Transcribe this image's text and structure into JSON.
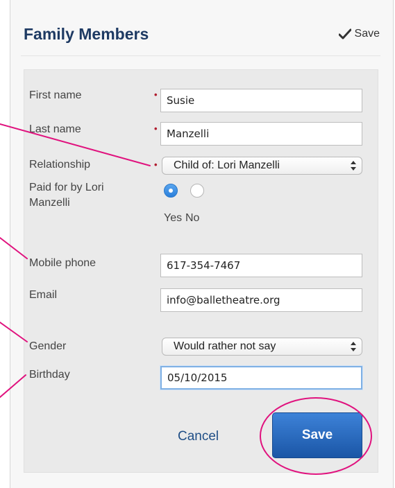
{
  "header": {
    "title": "Family Members",
    "save_label": "Save"
  },
  "form": {
    "first_name": {
      "label": "First name",
      "value": "Susie"
    },
    "last_name": {
      "label": "Last name",
      "value": "Manzelli"
    },
    "relationship": {
      "label": "Relationship",
      "selected": "Child of: Lori Manzelli"
    },
    "paid_by": {
      "label_line1": "Paid for by Lori",
      "label_line2": "Manzelli",
      "yes_label": "Yes",
      "no_label": "No",
      "selected": "yes"
    },
    "mobile_phone": {
      "label": "Mobile phone",
      "value": "617-354-7467"
    },
    "email": {
      "label": "Email",
      "value": "info@balletheatre.org"
    },
    "gender": {
      "label": "Gender",
      "selected": "Would rather not say"
    },
    "birthday": {
      "label": "Birthday",
      "value": "05/10/2015"
    }
  },
  "actions": {
    "cancel_label": "Cancel",
    "save_label": "Save"
  },
  "colors": {
    "title": "#1e3a63",
    "required_marker": "#b01c2e",
    "save_button": "#2a6cc4",
    "annotation": "#e0127e"
  }
}
